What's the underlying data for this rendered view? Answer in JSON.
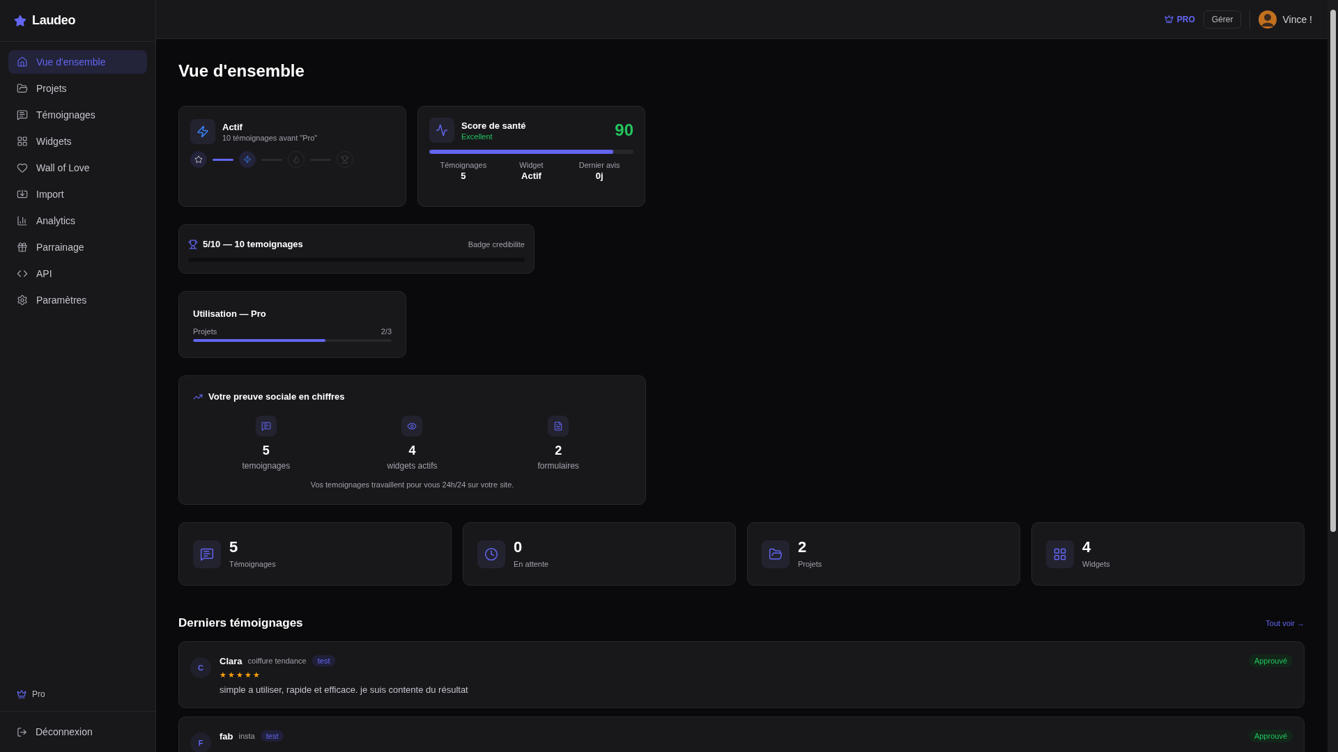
{
  "brand": {
    "name": "Laudeo"
  },
  "sidebar": {
    "items": [
      {
        "label": "Vue d'ensemble",
        "kind": "home",
        "selected": true
      },
      {
        "label": "Projets",
        "kind": "folder",
        "selected": false
      },
      {
        "label": "Témoignages",
        "kind": "message",
        "selected": false
      },
      {
        "label": "Widgets",
        "kind": "grid",
        "selected": false
      },
      {
        "label": "Wall of Love",
        "kind": "heart",
        "selected": false
      },
      {
        "label": "Import",
        "kind": "import",
        "selected": false
      },
      {
        "label": "Analytics",
        "kind": "chart",
        "selected": false
      },
      {
        "label": "Parrainage",
        "kind": "gift",
        "selected": false
      },
      {
        "label": "API",
        "kind": "code",
        "selected": false
      },
      {
        "label": "Paramètres",
        "kind": "settings",
        "selected": false
      }
    ],
    "plan": "Pro",
    "logout": "Déconnexion"
  },
  "header": {
    "plan_badge": "PRO",
    "manage_button": "Gérer",
    "user_name": "Vince !"
  },
  "title": "Vue d'ensemble",
  "level_card": {
    "title": "Actif",
    "subtitle": "10 témoignages avant \"Pro\"",
    "steps": [
      {
        "kind": "star",
        "reached": true
      },
      {
        "kind": "bolt",
        "reached": true
      },
      {
        "kind": "flame",
        "reached": false
      },
      {
        "kind": "trophy",
        "reached": false
      }
    ]
  },
  "health_card": {
    "title": "Score de santé",
    "rating": "Excellent",
    "score": "90",
    "level": 0.9,
    "stats": [
      {
        "label": "Témoignages",
        "value": "5"
      },
      {
        "label": "Widget",
        "value": "Actif"
      },
      {
        "label": "Dernier avis",
        "value": "0j"
      }
    ]
  },
  "badge_card": {
    "title": "5/10 — 10 temoignages",
    "note": "Badge credibilite",
    "level": 0
  },
  "usage_card": {
    "title": "Utilisation — Pro",
    "label": "Projets",
    "count": "2/3",
    "level": 0.667
  },
  "social_card": {
    "title": "Votre preuve sociale en chiffres",
    "metrics": [
      {
        "kind": "message",
        "value": "5",
        "label": "temoignages"
      },
      {
        "kind": "eye",
        "value": "4",
        "label": "widgets actifs"
      },
      {
        "kind": "file",
        "value": "2",
        "label": "formulaires"
      }
    ],
    "footer": "Vos temoignages travaillent pour vous 24h/24 sur votre site."
  },
  "stat_cards": [
    {
      "kind": "message",
      "value": "5",
      "label": "Témoignages"
    },
    {
      "kind": "clock",
      "value": "0",
      "label": "En attente"
    },
    {
      "kind": "folder",
      "value": "2",
      "label": "Projets"
    },
    {
      "kind": "grid",
      "value": "4",
      "label": "Widgets"
    }
  ],
  "recent": {
    "title": "Derniers témoignages",
    "see_all": "Tout voir →",
    "items": [
      {
        "initial": "C",
        "name": "Clara",
        "company": "coiffure tendance",
        "tag": "test",
        "status": "Approuvé",
        "stars": 5,
        "text": "simple a utiliser, rapide et efficace. je suis contente du résultat"
      },
      {
        "initial": "F",
        "name": "fab",
        "company": "insta",
        "tag": "test",
        "status": "Approuvé"
      }
    ]
  }
}
